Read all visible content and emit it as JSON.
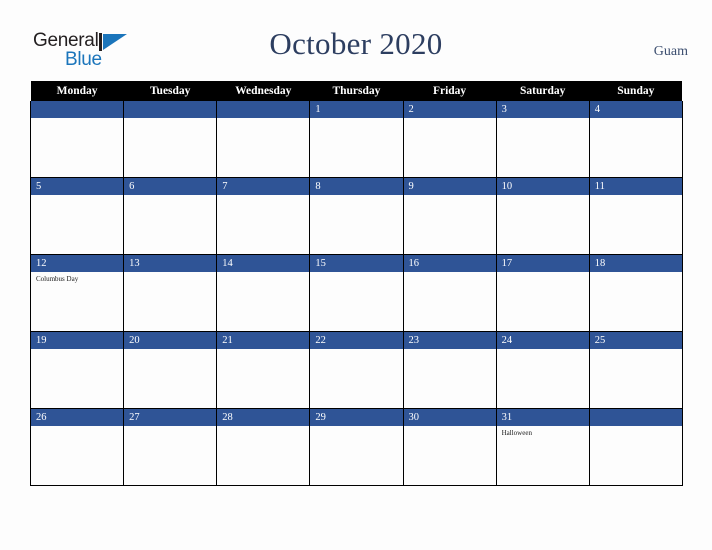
{
  "brand": {
    "name_part1": "General",
    "name_part2": "Blue",
    "mark_icon": "blue-triangle-icon",
    "colors": {
      "dark": "#231f20",
      "blue": "#1b75bb"
    }
  },
  "header": {
    "title": "October 2020",
    "region": "Guam",
    "title_color": "#2d3e60"
  },
  "calendar": {
    "accent_color": "#2f5496",
    "header_bg": "#000000",
    "weekday_headers": [
      "Monday",
      "Tuesday",
      "Wednesday",
      "Thursday",
      "Friday",
      "Saturday",
      "Sunday"
    ],
    "weeks": [
      [
        {
          "day": "",
          "events": []
        },
        {
          "day": "",
          "events": []
        },
        {
          "day": "",
          "events": []
        },
        {
          "day": "1",
          "events": []
        },
        {
          "day": "2",
          "events": []
        },
        {
          "day": "3",
          "events": []
        },
        {
          "day": "4",
          "events": []
        }
      ],
      [
        {
          "day": "5",
          "events": []
        },
        {
          "day": "6",
          "events": []
        },
        {
          "day": "7",
          "events": []
        },
        {
          "day": "8",
          "events": []
        },
        {
          "day": "9",
          "events": []
        },
        {
          "day": "10",
          "events": []
        },
        {
          "day": "11",
          "events": []
        }
      ],
      [
        {
          "day": "12",
          "events": [
            "Columbus Day"
          ]
        },
        {
          "day": "13",
          "events": []
        },
        {
          "day": "14",
          "events": []
        },
        {
          "day": "15",
          "events": []
        },
        {
          "day": "16",
          "events": []
        },
        {
          "day": "17",
          "events": []
        },
        {
          "day": "18",
          "events": []
        }
      ],
      [
        {
          "day": "19",
          "events": []
        },
        {
          "day": "20",
          "events": []
        },
        {
          "day": "21",
          "events": []
        },
        {
          "day": "22",
          "events": []
        },
        {
          "day": "23",
          "events": []
        },
        {
          "day": "24",
          "events": []
        },
        {
          "day": "25",
          "events": []
        }
      ],
      [
        {
          "day": "26",
          "events": []
        },
        {
          "day": "27",
          "events": []
        },
        {
          "day": "28",
          "events": []
        },
        {
          "day": "29",
          "events": []
        },
        {
          "day": "30",
          "events": []
        },
        {
          "day": "31",
          "events": [
            "Halloween"
          ]
        },
        {
          "day": "",
          "events": []
        }
      ]
    ]
  }
}
